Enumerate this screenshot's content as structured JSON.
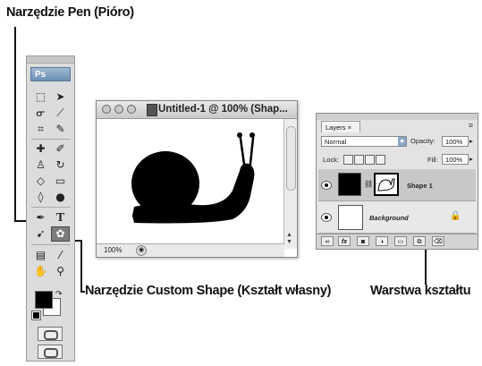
{
  "callouts": {
    "pen_tool": "Narzędzie Pen (Pióro)",
    "custom_shape_tool": "Narzędzie Custom Shape (Kształt własny)",
    "shape_layer": "Warstwa kształtu"
  },
  "toolbox": {
    "header": "Ps",
    "type_tool_glyph": "T"
  },
  "document": {
    "title": "Untitled-1 @ 100% (Shap...",
    "zoom": "100%"
  },
  "layers_panel": {
    "tab_label": "Layers ×",
    "blend_mode": "Normal",
    "opacity_label": "Opacity:",
    "opacity_value": "100%",
    "lock_label": "Lock:",
    "fill_label": "Fill:",
    "fill_value": "100%",
    "layers": [
      {
        "name": "Shape 1"
      },
      {
        "name": "Background"
      }
    ]
  },
  "colors": {
    "foreground": "#000000",
    "background": "#ffffff",
    "selected_layer": "#c8c8c8"
  }
}
